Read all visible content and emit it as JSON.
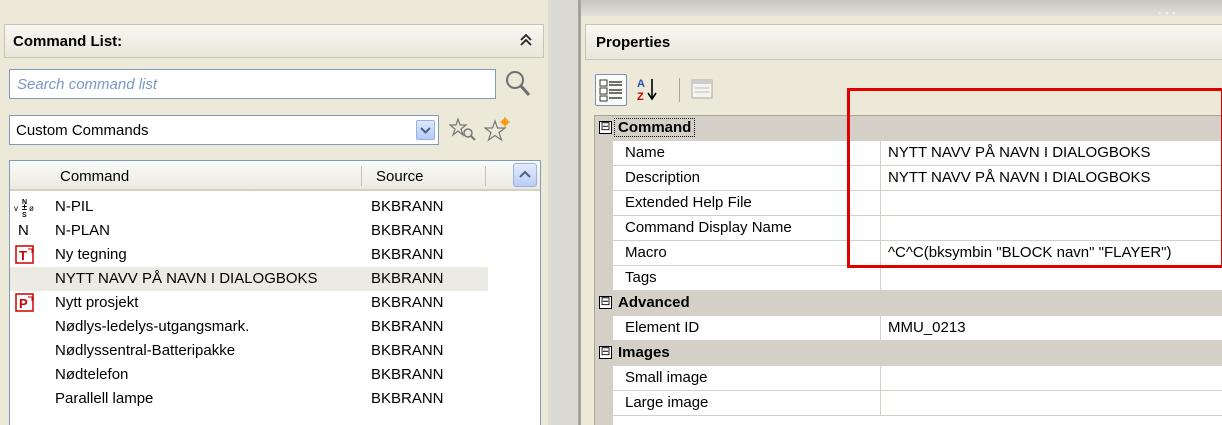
{
  "command_list": {
    "title": "Command List:",
    "search_placeholder": "Search command list",
    "filter_value": "Custom Commands",
    "columns": {
      "command": "Command",
      "source": "Source"
    },
    "rows": [
      {
        "icon": "north-arrow-icon",
        "name": "N-PIL",
        "source": "BKBRANN",
        "selected": false
      },
      {
        "icon": "letter-n-icon",
        "name": "N-PLAN",
        "source": "BKBRANN",
        "selected": false
      },
      {
        "icon": "text-block-icon",
        "name": "Ny tegning",
        "source": "BKBRANN",
        "selected": false
      },
      {
        "icon": "",
        "name": "NYTT NAVV PÅ NAVN I DIALOGBOKS",
        "source": "BKBRANN",
        "selected": true
      },
      {
        "icon": "project-block-icon",
        "name": "Nytt prosjekt",
        "source": "BKBRANN",
        "selected": false
      },
      {
        "icon": "",
        "name": "Nødlys-ledelys-utgangsmark.",
        "source": "BKBRANN",
        "selected": false
      },
      {
        "icon": "",
        "name": "Nødlyssentral-Batteripakke",
        "source": "BKBRANN",
        "selected": false
      },
      {
        "icon": "",
        "name": "Nødtelefon",
        "source": "BKBRANN",
        "selected": false
      },
      {
        "icon": "",
        "name": "Parallell lampe",
        "source": "BKBRANN",
        "selected": false
      }
    ],
    "row_letter_n": "N",
    "text_icon_letter": "T",
    "project_icon_letter": "P"
  },
  "properties": {
    "title": "Properties",
    "categories": {
      "command": {
        "label": "Command",
        "rows": {
          "name": {
            "label": "Name",
            "value": "NYTT NAVV PÅ NAVN I DIALOGBOKS"
          },
          "description": {
            "label": "Description",
            "value": "NYTT NAVV PÅ NAVN I DIALOGBOKS"
          },
          "help": {
            "label": "Extended Help File",
            "value": ""
          },
          "display": {
            "label": "Command Display Name",
            "value": ""
          },
          "macro": {
            "label": "Macro",
            "value": "^C^C(bksymbin \"BLOCK navn\" \"FLAYER\")"
          },
          "tags": {
            "label": "Tags",
            "value": ""
          }
        }
      },
      "advanced": {
        "label": "Advanced",
        "rows": {
          "element_id": {
            "label": "Element ID",
            "value": "MMU_0213"
          }
        }
      },
      "images": {
        "label": "Images",
        "rows": {
          "small": {
            "label": "Small image",
            "value": ""
          },
          "large": {
            "label": "Large image",
            "value": ""
          }
        }
      }
    },
    "toggle_symbol": "⊟"
  },
  "colors": {
    "highlight_box": "#e10000",
    "panel_bg": "#ece9d8",
    "selected_row": "#ecebe3"
  }
}
